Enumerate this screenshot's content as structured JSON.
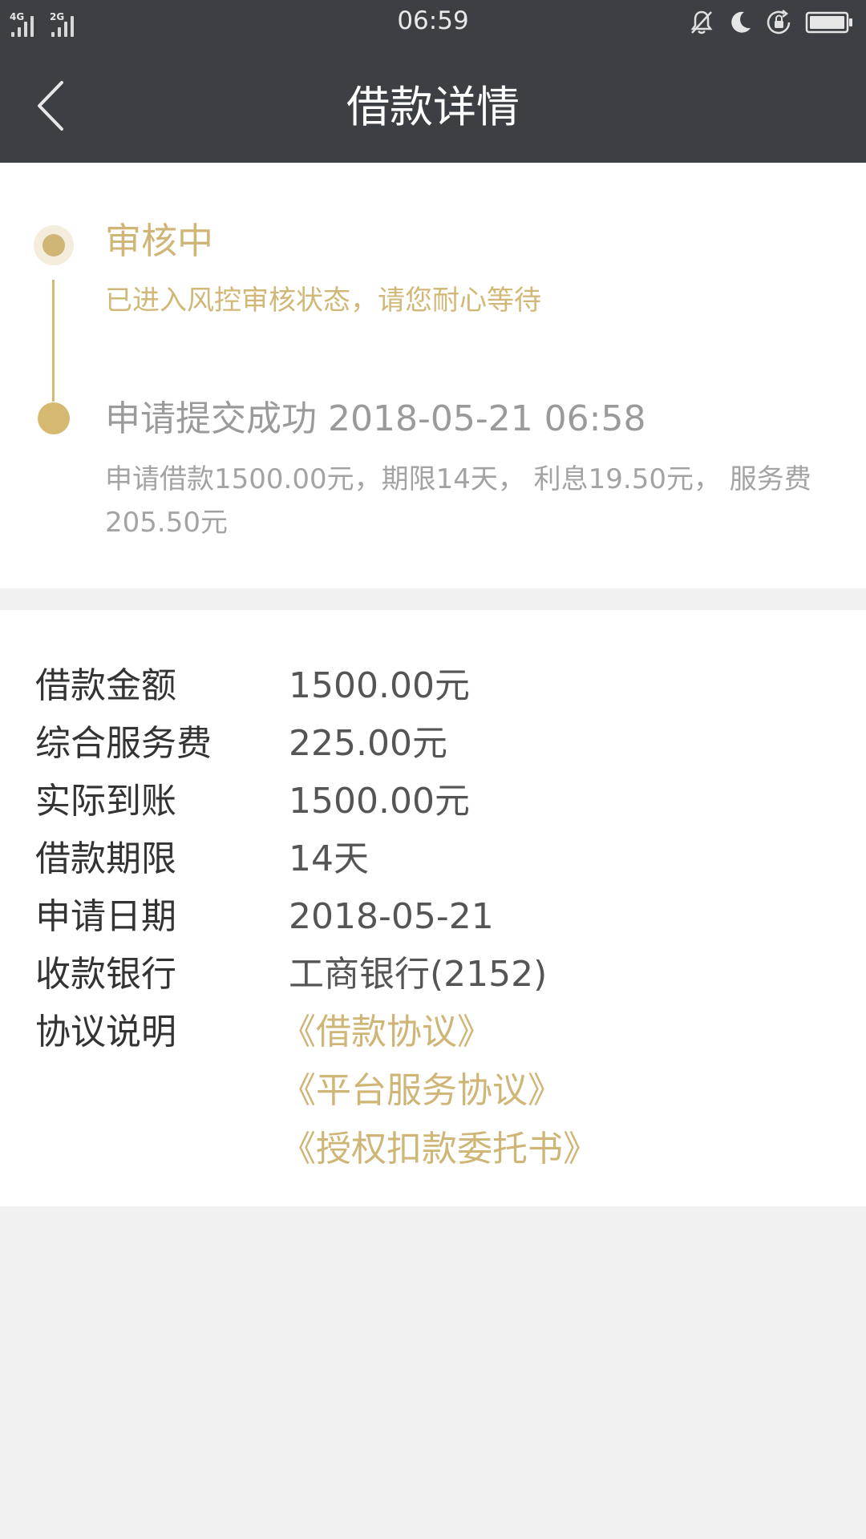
{
  "status_bar": {
    "time": "06:59",
    "network_1": "4G",
    "network_2": "2G"
  },
  "nav": {
    "title": "借款详情"
  },
  "timeline": {
    "steps": [
      {
        "title": "审核中",
        "desc": "已进入风控审核状态，请您耐心等待"
      },
      {
        "title": "申请提交成功 2018-05-21 06:58",
        "desc": "申请借款1500.00元，期限14天， 利息19.50元， 服务费205.50元"
      }
    ]
  },
  "details": {
    "rows": [
      {
        "label": "借款金额",
        "value": "1500.00元"
      },
      {
        "label": "综合服务费",
        "value": "225.00元"
      },
      {
        "label": "实际到账",
        "value": "1500.00元"
      },
      {
        "label": "借款期限",
        "value": "14天"
      },
      {
        "label": "申请日期",
        "value": "2018-05-21"
      },
      {
        "label": "收款银行",
        "value": "工商银行(2152)"
      }
    ],
    "agreement_label": "协议说明",
    "agreements": [
      "《借款协议》",
      "《平台服务协议》",
      "《授权扣款委托书》"
    ]
  },
  "colors": {
    "header_bg": "#3c3f43",
    "accent_gold": "#cfb677",
    "page_bg": "#f1f1f1"
  },
  "icons": {
    "back": "chevron-left-icon",
    "mute": "bell-muted-icon",
    "dnd": "moon-icon",
    "rotation_lock": "rotation-lock-icon",
    "battery": "battery-icon"
  }
}
